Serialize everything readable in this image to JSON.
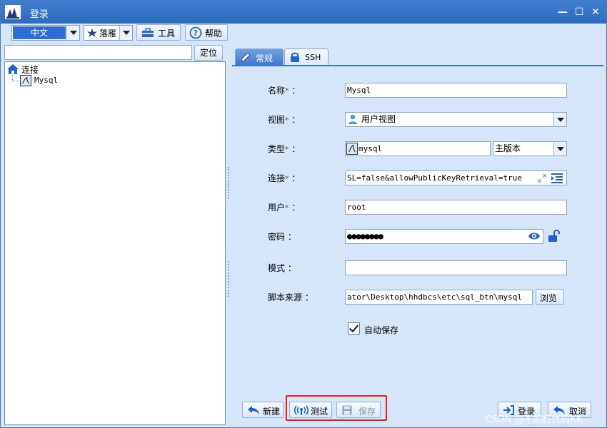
{
  "window": {
    "title": "登录"
  },
  "toolbar": {
    "language": "中文",
    "theme": "落雁",
    "tools_label": "工具",
    "help_label": "帮助"
  },
  "left_panel": {
    "search_value": "",
    "locate_label": "定位",
    "tree": {
      "root_label": "连接",
      "children": [
        {
          "label": "Mysql"
        }
      ]
    }
  },
  "tabs": [
    {
      "label": "常规",
      "active": true
    },
    {
      "label": "SSH",
      "active": false
    }
  ],
  "form": {
    "name": {
      "label": "名称",
      "required": "*",
      "colon": "：",
      "value": "Mysql"
    },
    "view": {
      "label": "视图",
      "required": "*",
      "colon": "：",
      "value": "用户视图"
    },
    "type": {
      "label": "类型",
      "required": "*",
      "colon": "：",
      "value": "mysql",
      "version": "主版本"
    },
    "connection": {
      "label": "连接",
      "required": "*",
      "colon": "：",
      "value": "SL=false&allowPublicKeyRetrieval=true"
    },
    "user": {
      "label": "用户",
      "required": "*",
      "colon": "：",
      "value": "root"
    },
    "password": {
      "label": "密码",
      "colon": "：",
      "value": "●●●●●●●●"
    },
    "schema": {
      "label": "模式",
      "colon": "：",
      "value": ""
    },
    "script_source": {
      "label": "脚本来源",
      "colon": "：",
      "value": "ator\\Desktop\\hhdbcs\\etc\\sql_btn\\mysql",
      "browse_label": "浏览"
    },
    "autosave": {
      "label": "自动保存",
      "checked": true
    }
  },
  "buttons": {
    "new": "新建",
    "test": "测试",
    "save": "保存",
    "login": "登录",
    "cancel": "取消"
  },
  "watermark": "CSDN @不如打代码KK",
  "colors": {
    "accent": "#2f6cd8",
    "title_bar": "#3a76c8",
    "panel_bg": "#d6e5f7",
    "highlight": "#e02222"
  }
}
